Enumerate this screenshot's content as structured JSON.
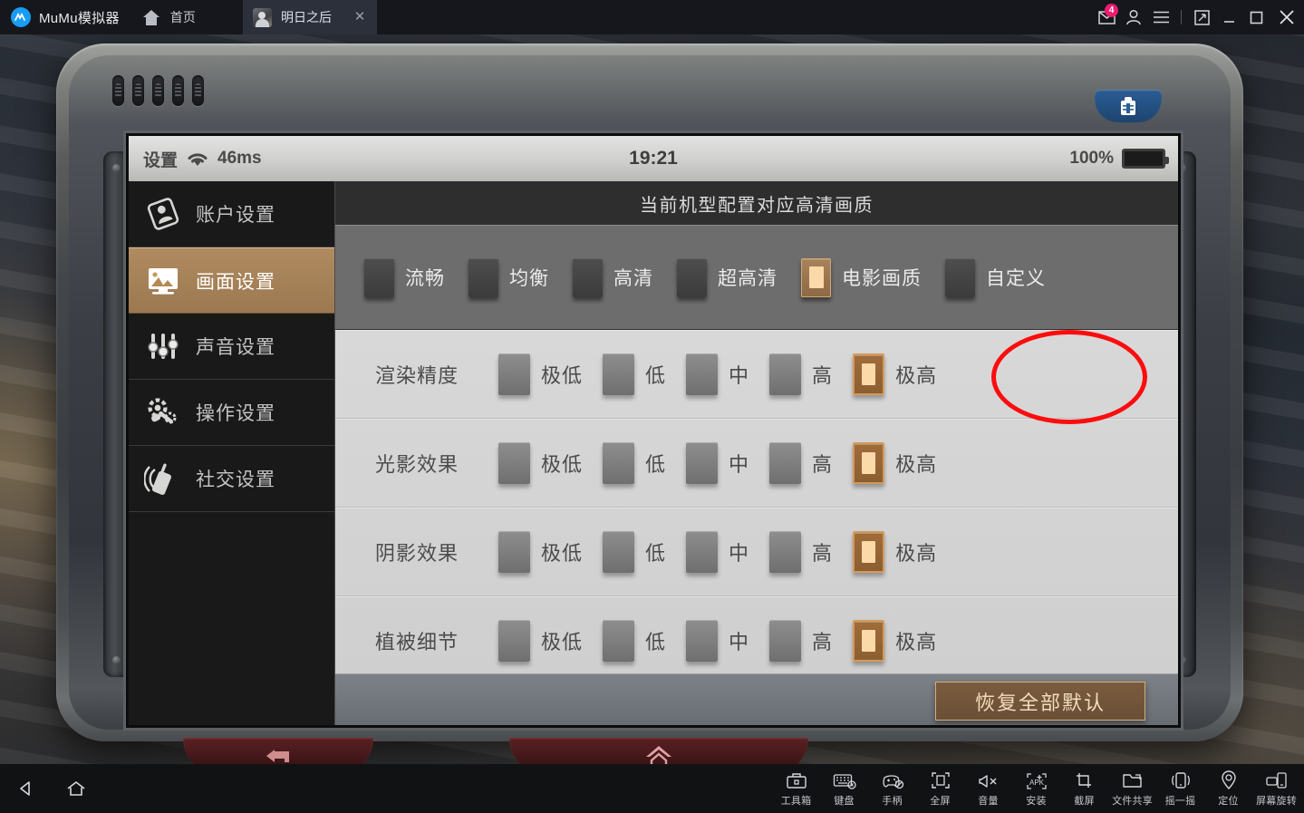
{
  "titlebar": {
    "app_name": "MuMu模拟器",
    "home_label": "首页",
    "home_icon": "home-icon",
    "logo_icon": "mumu-logo-icon",
    "tab": {
      "label": "明日之后",
      "icon": "game-avatar-icon",
      "close_icon": "close-icon"
    },
    "right_icons": [
      {
        "name": "inbox-icon",
        "badge": "4"
      },
      {
        "name": "user-icon",
        "badge": ""
      },
      {
        "name": "menu-icon",
        "badge": ""
      },
      {
        "name": "multi-window-icon",
        "badge": ""
      },
      {
        "name": "minimize-icon",
        "badge": ""
      },
      {
        "name": "maximize-icon",
        "badge": ""
      },
      {
        "name": "close-window-icon",
        "badge": ""
      }
    ]
  },
  "device": {
    "blue_button_icon": "backpack-icon",
    "back_button_icon": "back-arrow-icon",
    "home_button_icon": "house-icon"
  },
  "game": {
    "statusbar": {
      "title": "设置",
      "wifi_icon": "wifi-icon",
      "ping": "46ms",
      "time": "19:21",
      "battery_percent": "100%",
      "battery_icon": "battery-full-icon"
    },
    "sidebar": [
      {
        "label": "账户设置",
        "icon": "account-card-icon",
        "active": false
      },
      {
        "label": "画面设置",
        "icon": "picture-monitor-icon",
        "active": true
      },
      {
        "label": "声音设置",
        "icon": "sliders-icon",
        "active": false
      },
      {
        "label": "操作设置",
        "icon": "gear-wrench-icon",
        "active": false
      },
      {
        "label": "社交设置",
        "icon": "walkie-talkie-icon",
        "active": false
      }
    ],
    "preset_title": "当前机型配置对应高清画质",
    "presets": [
      {
        "label": "流畅",
        "selected": false
      },
      {
        "label": "均衡",
        "selected": false
      },
      {
        "label": "高清",
        "selected": false
      },
      {
        "label": "超高清",
        "selected": false
      },
      {
        "label": "电影画质",
        "selected": true
      },
      {
        "label": "自定义",
        "selected": false
      }
    ],
    "settings_rows": [
      {
        "label": "渲染精度",
        "options": [
          "极低",
          "低",
          "中",
          "高",
          "极高"
        ],
        "selected": 4
      },
      {
        "label": "光影效果",
        "options": [
          "极低",
          "低",
          "中",
          "高",
          "极高"
        ],
        "selected": 4
      },
      {
        "label": "阴影效果",
        "options": [
          "极低",
          "低",
          "中",
          "高",
          "极高"
        ],
        "selected": 4
      },
      {
        "label": "植被细节",
        "options": [
          "极低",
          "低",
          "中",
          "高",
          "极高"
        ],
        "selected": 4
      }
    ],
    "reset_button": "恢复全部默认",
    "annotation": {
      "shape": "ellipse",
      "color": "#fb0d0d",
      "targets": "电影画质"
    }
  },
  "bottombar": {
    "nav": [
      {
        "name": "android-back-icon"
      },
      {
        "name": "android-home-icon"
      }
    ],
    "tools": [
      {
        "label": "工具箱",
        "icon": "toolbox-icon"
      },
      {
        "label": "键盘",
        "icon": "keyboard-icon"
      },
      {
        "label": "手柄",
        "icon": "gamepad-icon"
      },
      {
        "label": "全屏",
        "icon": "fullscreen-icon"
      },
      {
        "label": "音量",
        "icon": "volume-mute-icon"
      },
      {
        "label": "安装",
        "icon": "apk-install-icon"
      },
      {
        "label": "截屏",
        "icon": "screenshot-icon"
      },
      {
        "label": "文件共享",
        "icon": "folder-share-icon"
      },
      {
        "label": "摇一摇",
        "icon": "shake-icon"
      },
      {
        "label": "定位",
        "icon": "location-pin-icon"
      },
      {
        "label": "屏幕旋转",
        "icon": "screen-rotate-icon"
      }
    ]
  },
  "colors": {
    "accent_orange": "#b08b61",
    "annotation_red": "#fb0d0d",
    "titlebar_bg": "#16171c",
    "badge_pink": "#ed1c6f"
  }
}
